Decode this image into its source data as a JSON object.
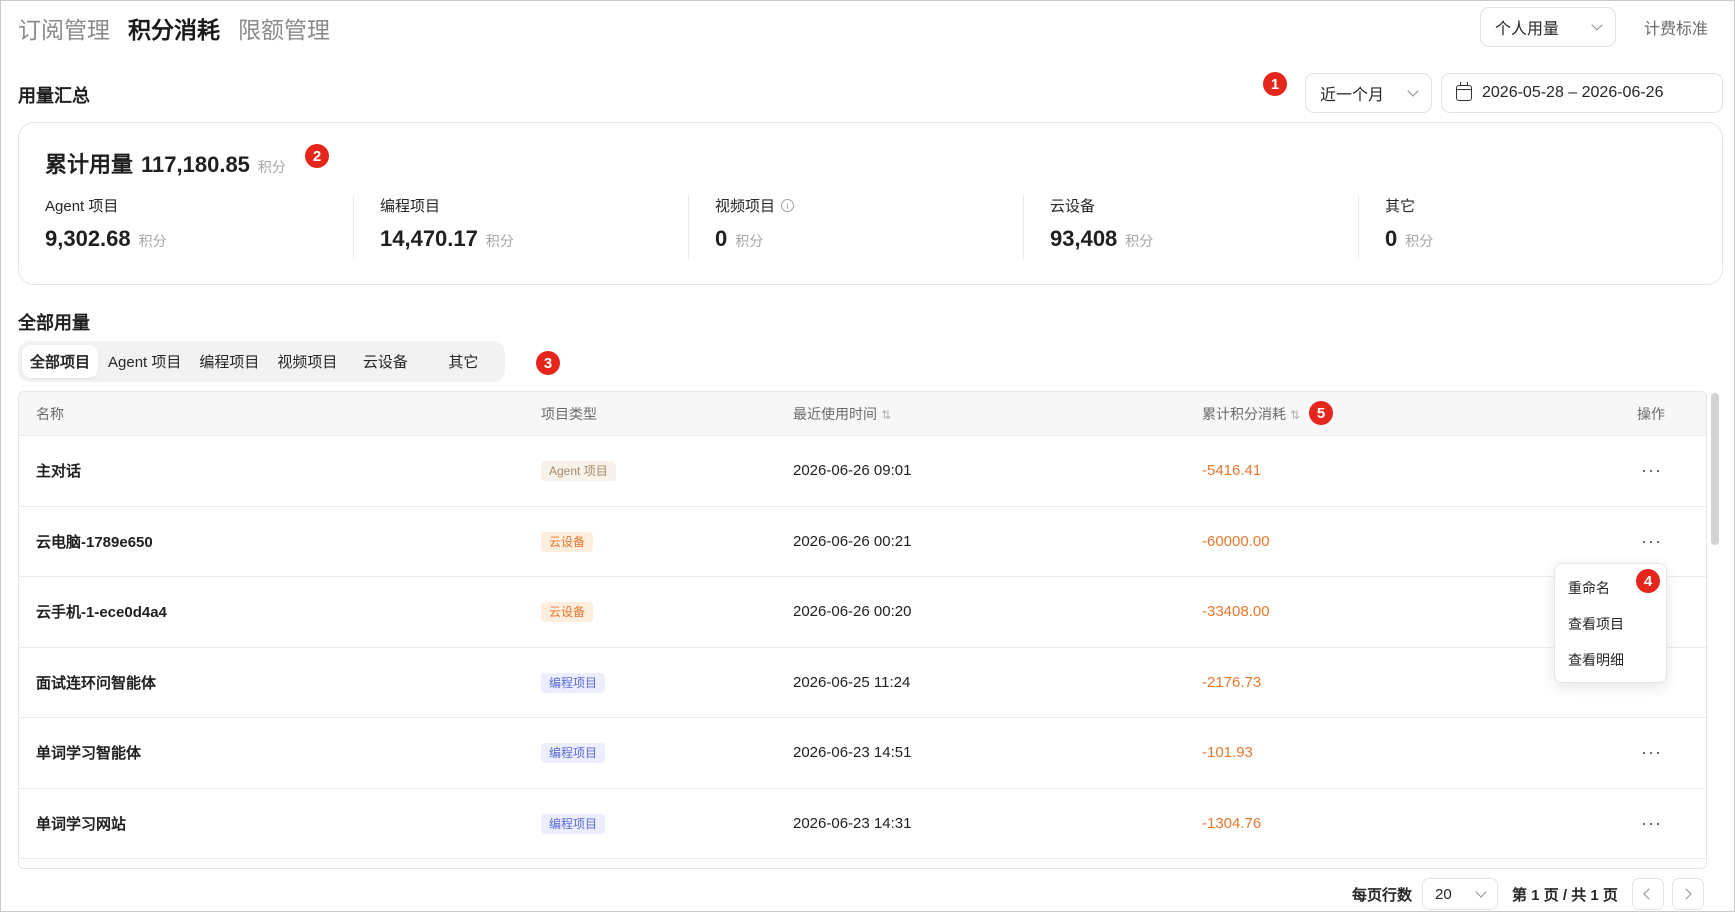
{
  "nav": {
    "tabs": [
      {
        "label": "订阅管理",
        "active": false
      },
      {
        "label": "积分消耗",
        "active": true
      },
      {
        "label": "限额管理",
        "active": false
      }
    ],
    "scope_select": "个人用量",
    "pricing_link": "计费标准"
  },
  "summary": {
    "title": "用量汇总",
    "range_select": "近一个月",
    "date_range": "2026-05-28 – 2026-06-26",
    "total_label": "累计用量",
    "total_value": "117,180.85",
    "unit": "积分",
    "stats": [
      {
        "label": "Agent 项目",
        "value": "9,302.68",
        "unit": "积分"
      },
      {
        "label": "编程项目",
        "value": "14,470.17",
        "unit": "积分"
      },
      {
        "label": "视频项目",
        "value": "0",
        "unit": "积分",
        "info": true
      },
      {
        "label": "云设备",
        "value": "93,408",
        "unit": "积分"
      },
      {
        "label": "其它",
        "value": "0",
        "unit": "积分"
      }
    ]
  },
  "usage": {
    "title": "全部用量",
    "filters": [
      "全部项目",
      "Agent 项目",
      "编程项目",
      "视频项目",
      "云设备",
      "其它"
    ],
    "active_filter": 0,
    "columns": {
      "name": "名称",
      "type": "项目类型",
      "time": "最近使用时间",
      "cost": "累计积分消耗",
      "action": "操作"
    },
    "rows": [
      {
        "name": "主对话",
        "type": "Agent 项目",
        "type_kind": "agent",
        "time": "2026-06-26 09:01",
        "cost": "-5416.41"
      },
      {
        "name": "云电脑-1789e650",
        "type": "云设备",
        "type_kind": "cloud",
        "time": "2026-06-26 00:21",
        "cost": "-60000.00"
      },
      {
        "name": "云手机-1-ece0d4a4",
        "type": "云设备",
        "type_kind": "cloud",
        "time": "2026-06-26 00:20",
        "cost": "-33408.00"
      },
      {
        "name": "面试连环问智能体",
        "type": "编程项目",
        "type_kind": "code",
        "time": "2026-06-25 11:24",
        "cost": "-2176.73"
      },
      {
        "name": "单词学习智能体",
        "type": "编程项目",
        "type_kind": "code",
        "time": "2026-06-23 14:51",
        "cost": "-101.93"
      },
      {
        "name": "单词学习网站",
        "type": "编程项目",
        "type_kind": "code",
        "time": "2026-06-23 14:31",
        "cost": "-1304.76"
      }
    ]
  },
  "context_menu": [
    "重命名",
    "查看项目",
    "查看明细"
  ],
  "pagination": {
    "rows_label": "每页行数",
    "page_size": "20",
    "page_info": "第 1 页 / 共 1 页"
  },
  "badges": [
    "1",
    "2",
    "3",
    "4",
    "5"
  ],
  "colors": {
    "badge": "#e5261c",
    "cost": "#e8772e",
    "agent_tag": "#a8896a",
    "cloud_tag": "#e8772e",
    "code_tag": "#5b6bd8"
  }
}
